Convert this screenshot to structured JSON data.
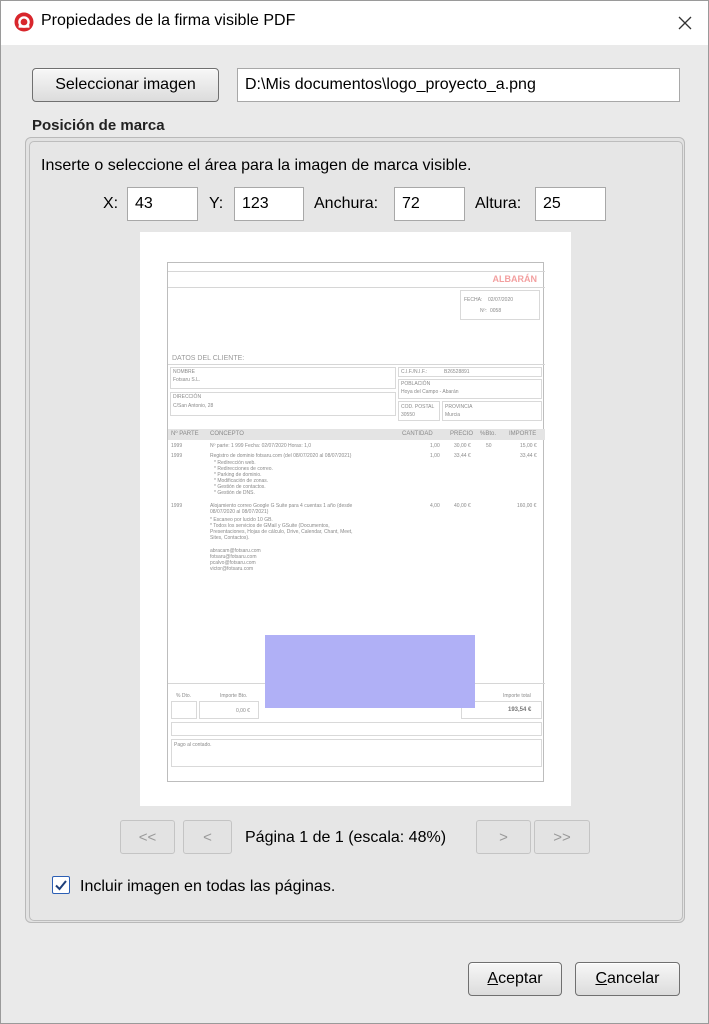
{
  "window": {
    "title": "Propiedades de la firma visible PDF",
    "app_icon": "app-logo-icon",
    "close_icon": "close-icon"
  },
  "image": {
    "select_label": "Seleccionar imagen",
    "path_value": "D:\\Mis documentos\\logo_proyecto_a.png"
  },
  "position": {
    "section_title": "Posición de marca",
    "instructions": "Inserte o seleccione el área para la imagen de marca visible.",
    "x_label": "X:",
    "x_value": "43",
    "y_label": "Y:",
    "y_value": "123",
    "width_label": "Anchura:",
    "width_value": "72",
    "height_label": "Altura:",
    "height_value": "25"
  },
  "preview_doc": {
    "doc_title": "ALBARÁN",
    "fecha_label": "FECHA:",
    "fecha_value": "02/07/2020",
    "num_label": "Nº:",
    "num_value": "0058",
    "client_section": "DATOS DEL CLIENTE:",
    "nombre_label": "NOMBRE",
    "nombre_value": "Fotsaru S.L.",
    "cif_label": "C.I.F./N.I.F.:",
    "cif_value": "B26528891",
    "poblacion_label": "POBLACIÓN",
    "poblacion_value": "Hoya del Campo - Abarán",
    "direccion_label": "DIRECCIÓN",
    "direccion_value": "C/San Antonio, 28",
    "cp_label": "COD. POSTAL",
    "cp_value": "30550",
    "provincia_label": "PROVINCIA",
    "provincia_value": "Murcia",
    "table_headers": [
      "Nº PARTE",
      "CONCEPTO",
      "CANTIDAD",
      "PRECIO",
      "%Bto.",
      "IMPORTE"
    ],
    "rows": [
      {
        "parte": "1999",
        "concepto": "Nº parte: 1 999  Fecha: 02/07/2020  Horas: 1,0",
        "cantidad": "1,00",
        "precio": "30,00 €",
        "dto": "50",
        "importe": "15,00 €"
      },
      {
        "parte": "1999",
        "concepto": "Registro de dominio fotsaru.com (del 08/07/2020 al 08/07/2021)",
        "cantidad": "1,00",
        "precio": "33,44 €",
        "dto": "",
        "importe": "33,44 €"
      },
      {
        "parte": "1999",
        "concepto": "Alojamiento correo Google G Suite para 4 cuentas 1 año (desde 08/07/2020 al 08/07/2021)",
        "cantidad": "4,00",
        "precio": "40,00 €",
        "dto": "",
        "importe": "160,00 €"
      }
    ],
    "row2_details": [
      "* Redirección web.",
      "* Redirecciones de correo.",
      "* Parking de dominio.",
      "* Modificación de zonas.",
      "* Gestión de contactos.",
      "* Gestión de DNS."
    ],
    "row3_details": [
      "* Escaneo por lucido 10 GB.",
      "* Todos los servicios de GMail y GSuite (Documentos,",
      "Presentaciones, Hojas de cálculo, Drive, Calendar, Chant, Meet,",
      "Sites, Contactos)."
    ],
    "emails": [
      "abracam@fotsaru.com",
      "fotsaru@fotsaru.com",
      "pcalvo@fotsaru.com",
      "victor@fotsaru.com"
    ],
    "dto_label": "% Dto.",
    "base_label": "Importe Bto.",
    "base_value": "0,00 €",
    "total_label": "Importe total",
    "total_value": "193,54 €",
    "payment_label": "Pago al contado."
  },
  "navigation": {
    "first_label": "<<",
    "prev_label": "<",
    "page_info": "Página 1 de 1 (escala: 48%)",
    "next_label": ">",
    "last_label": ">>"
  },
  "options": {
    "all_pages_label": "Incluir imagen en todas las páginas.",
    "all_pages_checked": true
  },
  "footer": {
    "accept_accel": "A",
    "accept_rest": "ceptar",
    "cancel_accel": "C",
    "cancel_rest": "ancelar"
  }
}
